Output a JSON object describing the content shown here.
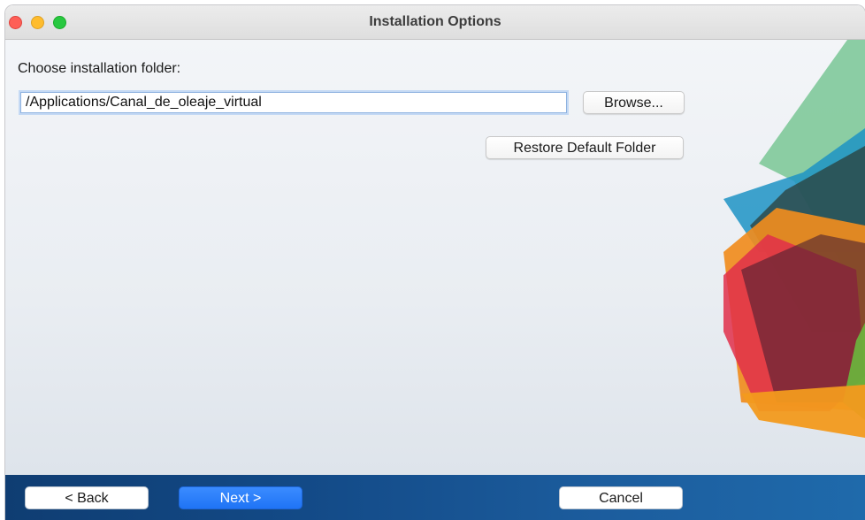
{
  "window": {
    "title": "Installation Options"
  },
  "main": {
    "folder_label": "Choose installation folder:",
    "folder_path": "/Applications/Canal_de_oleaje_virtual",
    "browse_label": "Browse...",
    "restore_label": "Restore Default Folder"
  },
  "footer": {
    "back_label": "< Back",
    "next_label": "Next >",
    "cancel_label": "Cancel"
  },
  "colors": {
    "footer_bar": "#134a87",
    "next_button": "#2a80ff",
    "traffic_red": "#fe5f57",
    "traffic_yellow": "#febc2e",
    "traffic_green": "#28c840"
  }
}
